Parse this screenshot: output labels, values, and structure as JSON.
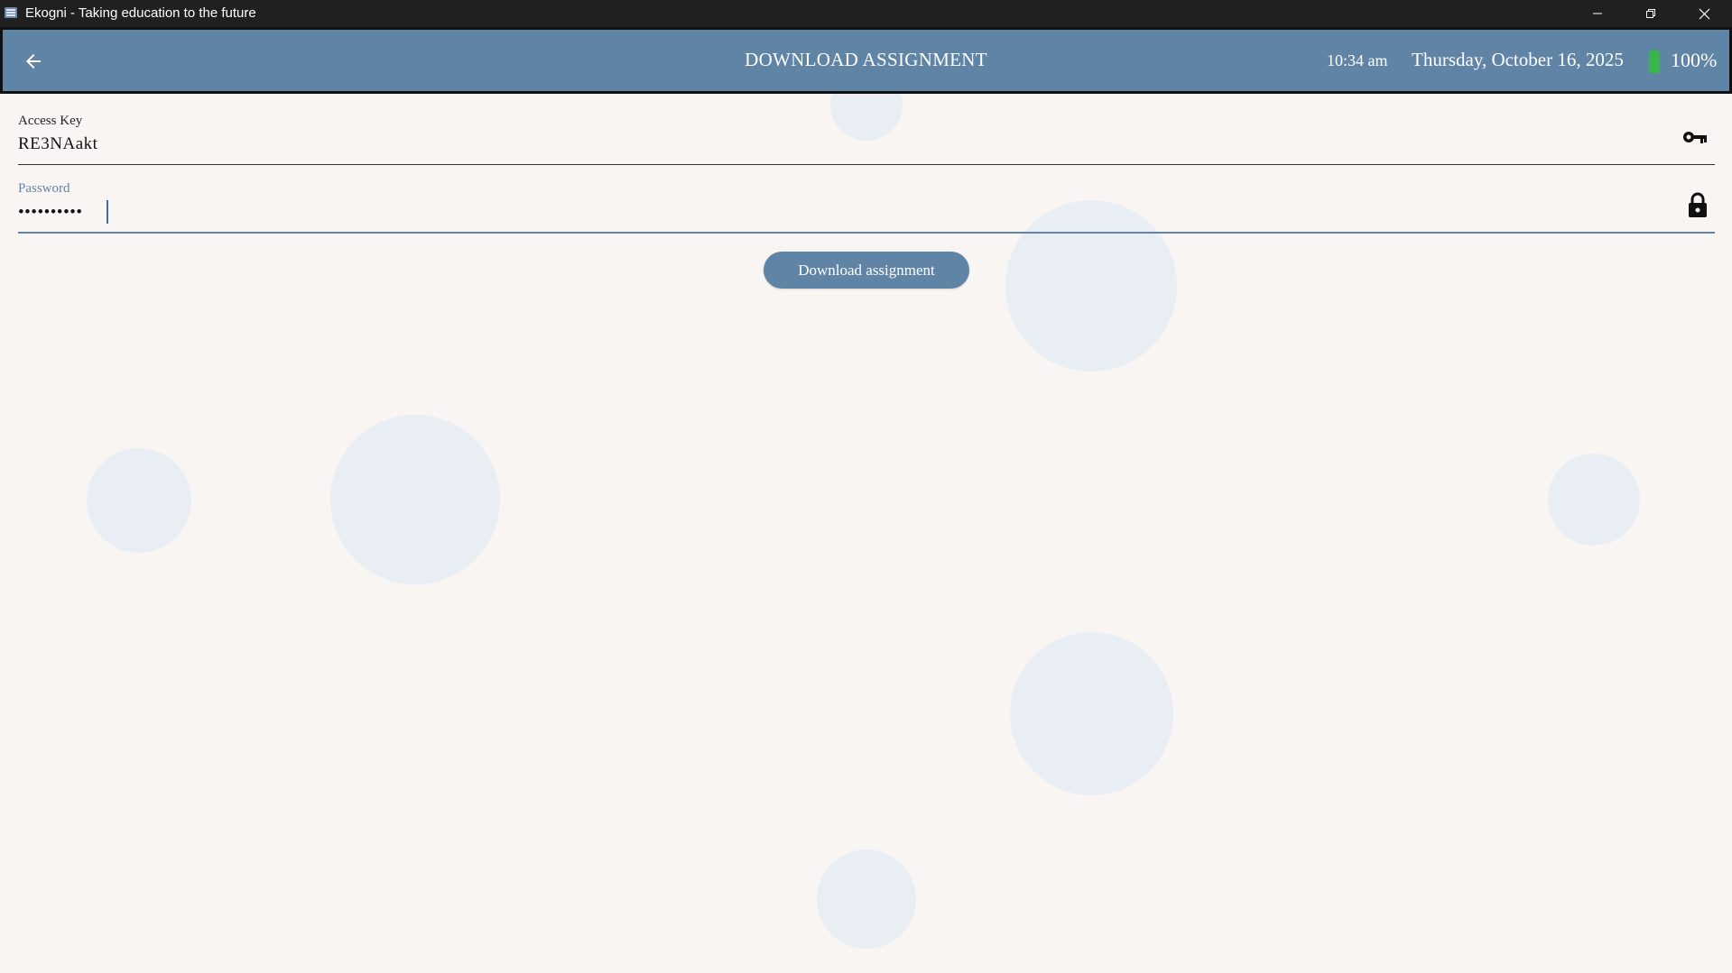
{
  "window": {
    "title": "Ekogni - Taking education to the future",
    "app_icon": "ekogni-app-icon",
    "controls": [
      "minimize-icon",
      "restore-icon",
      "close-icon"
    ]
  },
  "header": {
    "back_icon": "arrow-left-icon",
    "title": "DOWNLOAD ASSIGNMENT",
    "time": "10:34 am",
    "date": "Thursday, October 16, 2025",
    "battery_icon": "battery-icon",
    "battery_percent": "100%",
    "battery_level": 1.0,
    "battery_color": "#3ab54a"
  },
  "form": {
    "access_key": {
      "label": "Access Key",
      "value": "RE3NAakt",
      "icon": "key-icon"
    },
    "password": {
      "label": "Password",
      "value": "••••••••••",
      "icon": "lock-icon",
      "focused": true
    },
    "download_button": {
      "label": "Download assignment"
    }
  },
  "colors": {
    "accent": "#6084a6",
    "background": "#f8f5f2",
    "bubble": "#e9eef5",
    "titlebar": "#202020"
  }
}
